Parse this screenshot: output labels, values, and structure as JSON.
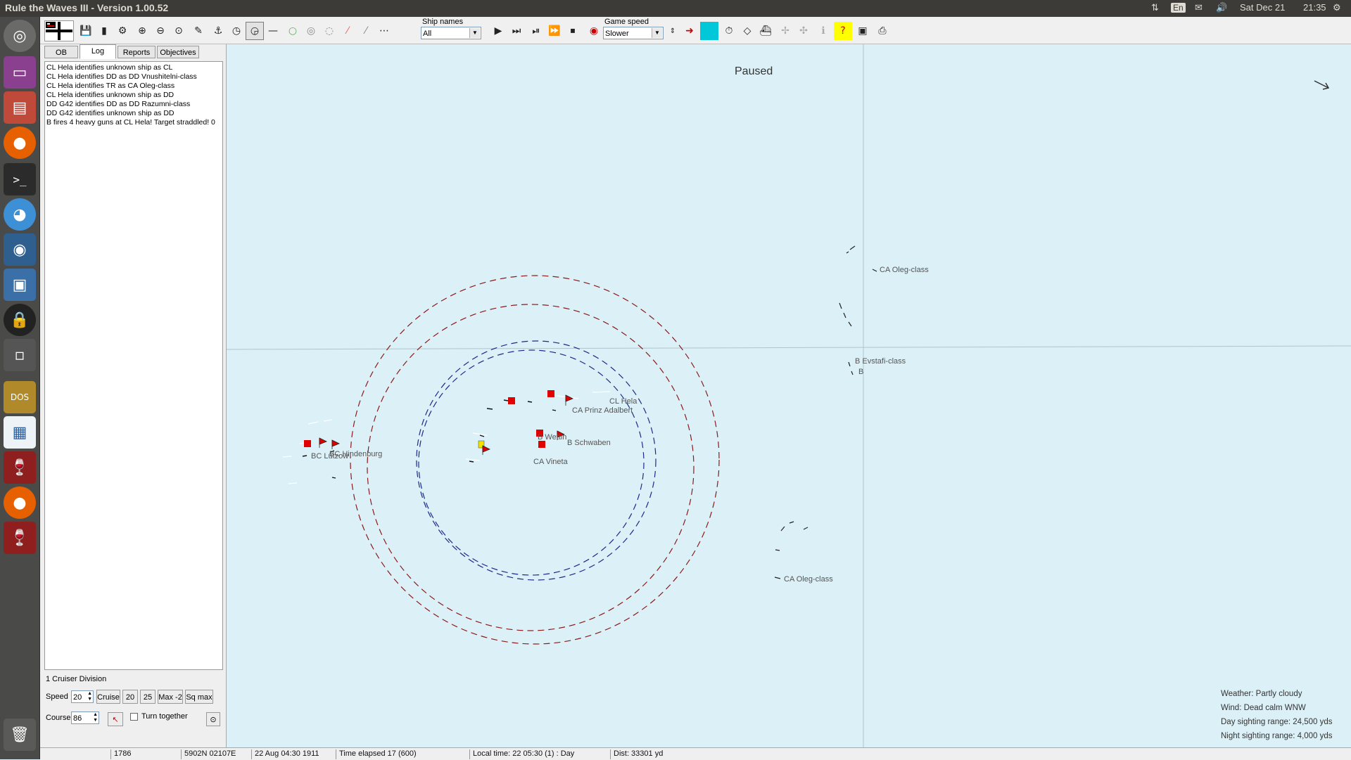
{
  "system": {
    "app_title": "Rule the Waves III - Version 1.00.52",
    "language": "En",
    "date": "Sat Dec 21",
    "time": "21:35"
  },
  "toolbar": {
    "ship_names_label": "Ship names",
    "ship_names_value": "All",
    "game_speed_label": "Game speed",
    "game_speed_value": "Slower"
  },
  "left_panel": {
    "tabs": [
      "OB",
      "Log",
      "Reports",
      "Objectives"
    ],
    "active_tab": "Log",
    "log_lines": [
      "CL Hela identifies unknown ship as CL",
      "CL Hela identifies DD as DD Vnushitelni-class",
      "CL Hela identifies TR as CA Oleg-class",
      "CL Hela identifies unknown ship as DD",
      "DD G42 identifies DD as DD Razumni-class",
      "DD G42 identifies unknown ship as DD",
      "B fires 4 heavy guns at CL Hela! Target straddled!  0"
    ],
    "division_label": "1 Cruiser Division",
    "speed_label": "Speed",
    "speed_value": "20",
    "speed_buttons": [
      "Cruise",
      "20",
      "25",
      "Max -2",
      "Sq max"
    ],
    "course_label": "Course",
    "course_value": "86",
    "turn_together_label": "Turn together"
  },
  "map": {
    "paused_label": "Paused",
    "ship_labels": [
      "CA Oleg-class",
      "B Evstafi-class",
      "B",
      "CL Hela",
      "CA Prinz Adalbert",
      "B Wettin",
      "B Schwaben",
      "CA Vineta",
      "BC Lützow",
      "BC Hindenburg",
      "CA Oleg-class"
    ],
    "weather": {
      "weather": "Weather: Partly cloudy",
      "wind": "Wind: Dead calm  WNW",
      "day_range": "Day sighting range: 24,500 yds",
      "night_range": "Night sighting range: 4,000 yds"
    }
  },
  "status_bar": {
    "field1": "1786",
    "position": "5902N 02107E",
    "date": "22 Aug 04:30 1911",
    "time_elapsed": "Time elapsed 17 (600)",
    "local_time": "Local time: 22 05:30 (1) : Day",
    "dist": "Dist: 33301 yd"
  },
  "colors": {
    "sea": "#dcf0f7",
    "german": "#e00000",
    "flagship": "#f2e200",
    "range_red": "#8b1a1a",
    "range_blue": "#1a2a8b"
  }
}
